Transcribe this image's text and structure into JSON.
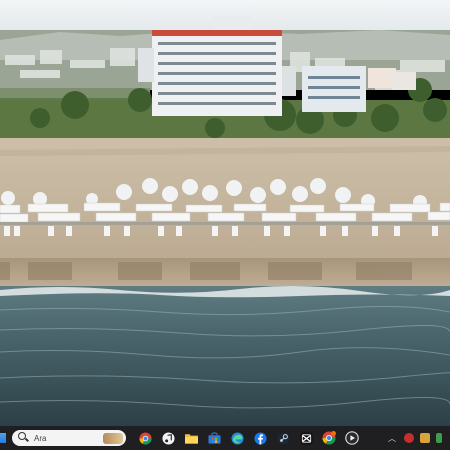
{
  "taskbar": {
    "search": {
      "placeholder": "Ara"
    },
    "pinned": [
      {
        "icon": "chrome-icon"
      },
      {
        "icon": "music-icon"
      },
      {
        "icon": "file-explorer-icon"
      },
      {
        "icon": "store-icon"
      },
      {
        "icon": "edge-icon"
      },
      {
        "icon": "facebook-icon"
      },
      {
        "icon": "steam-icon"
      },
      {
        "icon": "capcut-icon"
      },
      {
        "icon": "chrome-notification-icon"
      },
      {
        "icon": "media-player-icon"
      }
    ],
    "tray": [
      {
        "icon": "show-hidden-icons-chevron"
      },
      {
        "icon": "tray-app-icon"
      },
      {
        "icon": "tray-app-icon-2"
      },
      {
        "icon": "tray-app-icon-3"
      }
    ]
  },
  "colors": {
    "sky": "#e8eef2",
    "sea": "#3f5a63",
    "sand": "#cbbba4",
    "taskbar": "#1f1f22"
  }
}
